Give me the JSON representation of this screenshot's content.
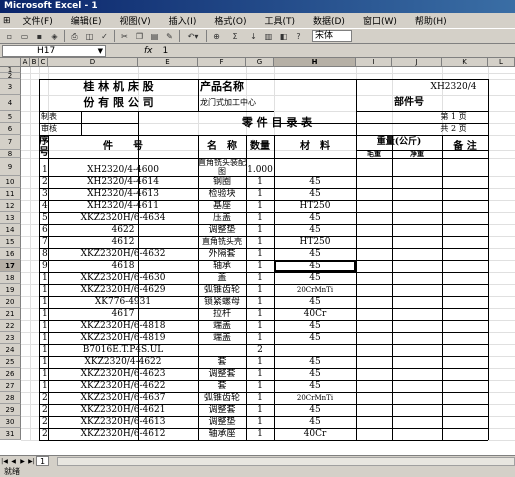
{
  "window": {
    "title": "Microsoft Excel - 1"
  },
  "menu": [
    "文件(F)",
    "编辑(E)",
    "视图(V)",
    "插入(I)",
    "格式(O)",
    "工具(T)",
    "数据(D)",
    "窗口(W)",
    "帮助(H)"
  ],
  "toolbar": {
    "zoom_icon": "Σ",
    "font": "宋体"
  },
  "formula_bar": {
    "name_box": "H17",
    "fx": "fx",
    "value": "1"
  },
  "columns": [
    "A",
    "B",
    "C",
    "D",
    "E",
    "F",
    "G",
    "H",
    "I",
    "J",
    "K",
    "L"
  ],
  "rows": [
    "1",
    "2",
    "3",
    "4",
    "5",
    "6",
    "7",
    "8",
    "9",
    "10",
    "11",
    "12",
    "13",
    "14",
    "15",
    "16",
    "17",
    "18",
    "19",
    "20",
    "21",
    "22",
    "23",
    "24",
    "25",
    "26",
    "27",
    "28",
    "29",
    "30",
    "31"
  ],
  "header": {
    "company_line1": "桂 林 机 床 股",
    "company_line2": "份 有 限 公 司",
    "product_name_label": "产品名称",
    "product_code": "XH2320/4",
    "product_name": "龙门式加工中心",
    "part_no_label": "部件号",
    "prepared": "制表",
    "reviewed": "审核",
    "catalog_title": "零 件 目 录 表",
    "page_no": "第 1 页",
    "total_pages": "共 2 页",
    "col_seq": "序号",
    "col_partno": "件　　号",
    "col_name": "名　称",
    "col_qty": "数量",
    "col_material": "材　料",
    "col_weight": "重量(公斤)",
    "col_gross": "毛重",
    "col_net": "净重",
    "col_remark": "备 注"
  },
  "parts": [
    {
      "seq": "1",
      "partno": "XH2320/4-4600",
      "name": "直角铣头装配图",
      "qty": "1.000",
      "mat": ""
    },
    {
      "seq": "2",
      "partno": "XH2320/4-4614",
      "name": "钢圈",
      "qty": "1",
      "mat": "45"
    },
    {
      "seq": "3",
      "partno": "XH2320/4-4613",
      "name": "检验块",
      "qty": "1",
      "mat": "45"
    },
    {
      "seq": "4",
      "partno": "XH2320/4-4611",
      "name": "基座",
      "qty": "1",
      "mat": "HT250"
    },
    {
      "seq": "5",
      "partno": "XKZ2320H/6-4634",
      "name": "压盖",
      "qty": "1",
      "mat": "45"
    },
    {
      "seq": "6",
      "partno": "4622",
      "name": "调整垫",
      "qty": "1",
      "mat": "45"
    },
    {
      "seq": "7",
      "partno": "4612",
      "name": "直角铣头壳",
      "qty": "1",
      "mat": "HT250"
    },
    {
      "seq": "8",
      "partno": "XKZ2320H/6-4632",
      "name": "外隔套",
      "qty": "1",
      "mat": "45"
    },
    {
      "seq": "9",
      "partno": "4618",
      "name": "轴承",
      "qty": "1",
      "mat": "45"
    },
    {
      "seq": "10",
      "partno": "XKZ2320H/6-4630",
      "name": "盖",
      "qty": "1",
      "mat": "45"
    },
    {
      "seq": "11",
      "partno": "XKZ2320H/6-4629",
      "name": "弧锥齿轮",
      "qty": "1",
      "mat": "20CrMnTi"
    },
    {
      "seq": "12",
      "partno": "XK776-4931",
      "name": "锁紧螺母",
      "qty": "1",
      "mat": "45"
    },
    {
      "seq": "13",
      "partno": "4617",
      "name": "拉杆",
      "qty": "1",
      "mat": "40Cr"
    },
    {
      "seq": "14",
      "partno": "XKZ2320H/6-4818",
      "name": "端盖",
      "qty": "1",
      "mat": "45"
    },
    {
      "seq": "15",
      "partno": "XKZ2320H/6-4819",
      "name": "端盖",
      "qty": "1",
      "mat": "45"
    },
    {
      "seq": "16",
      "partno": "B7016E.T.P4S.UL",
      "name": "",
      "qty": "2",
      "mat": ""
    },
    {
      "seq": "17",
      "partno": "XKZ2320/4-4622",
      "name": "套",
      "qty": "1",
      "mat": "45"
    },
    {
      "seq": "18",
      "partno": "XKZ2320H/6-4623",
      "name": "调整套",
      "qty": "1",
      "mat": "45"
    },
    {
      "seq": "19",
      "partno": "XKZ2320H/6-4622",
      "name": "套",
      "qty": "1",
      "mat": "45"
    },
    {
      "seq": "20",
      "partno": "XKZ2320H/6-4637",
      "name": "弧锥齿轮",
      "qty": "1",
      "mat": "20CrMnTi"
    },
    {
      "seq": "21",
      "partno": "XKZ2320H/6-4621",
      "name": "调整套",
      "qty": "1",
      "mat": "45"
    },
    {
      "seq": "22",
      "partno": "XKZ2320H/6-4613",
      "name": "调整垫",
      "qty": "1",
      "mat": "45"
    },
    {
      "seq": "23",
      "partno": "XKZ2320H/6-4612",
      "name": "轴承座",
      "qty": "1",
      "mat": "40Cr"
    }
  ],
  "sheet_tab": "1",
  "status": "就绪"
}
